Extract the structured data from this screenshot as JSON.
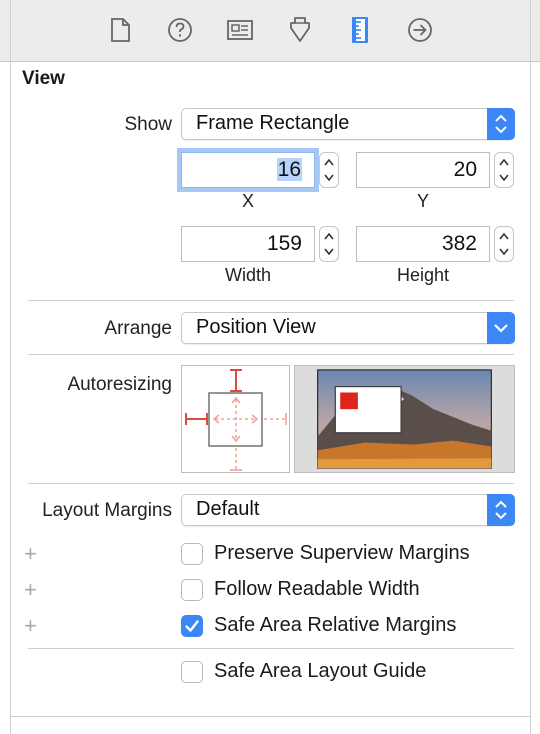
{
  "toolbar": {
    "tabs": [
      {
        "icon": "file-icon"
      },
      {
        "icon": "help-icon"
      },
      {
        "icon": "identity-card-icon"
      },
      {
        "icon": "attributes-arrow-icon"
      },
      {
        "icon": "ruler-icon",
        "selected": true
      },
      {
        "icon": "connections-arrow-icon"
      }
    ]
  },
  "section": {
    "title": "View"
  },
  "show": {
    "label": "Show",
    "value": "Frame Rectangle"
  },
  "frame": {
    "x": {
      "value": "16",
      "caption": "X"
    },
    "y": {
      "value": "20",
      "caption": "Y"
    },
    "width": {
      "value": "159",
      "caption": "Width"
    },
    "height": {
      "value": "382",
      "caption": "Height"
    }
  },
  "arrange": {
    "label": "Arrange",
    "value": "Position View"
  },
  "autoresizing": {
    "label": "Autoresizing"
  },
  "layout_margins": {
    "label": "Layout Margins",
    "value": "Default"
  },
  "checkboxes": [
    {
      "label": "Preserve Superview Margins",
      "checked": false
    },
    {
      "label": "Follow Readable Width",
      "checked": false
    },
    {
      "label": "Safe Area Relative Margins",
      "checked": true
    }
  ],
  "safe_area_guide": {
    "label": "Safe Area Layout Guide",
    "checked": false
  },
  "plus_symbol": "+",
  "colors": {
    "accent": "#3b87f5",
    "strut": "#e0493d",
    "inactive_strut": "#f0a29b"
  }
}
